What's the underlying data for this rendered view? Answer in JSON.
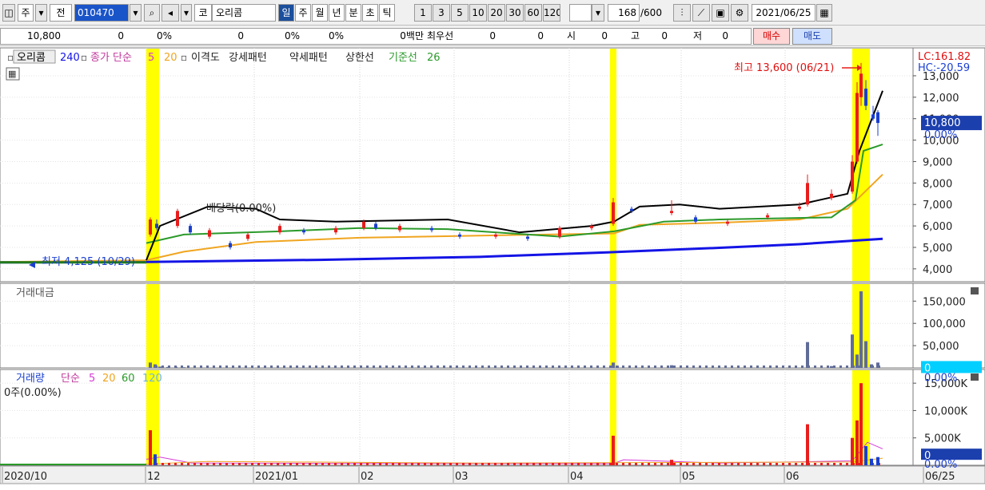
{
  "toolbar": {
    "type_main": "주",
    "type_all": "전",
    "code": "010470",
    "market": "코",
    "name": "오리콤",
    "periods": [
      "일",
      "주",
      "월",
      "년",
      "분",
      "초",
      "틱"
    ],
    "active_period": "일",
    "intervals": [
      "1",
      "3",
      "5",
      "10",
      "20",
      "30",
      "60",
      "120"
    ],
    "count": "168",
    "count_total": "/600",
    "date": "2021/06/25"
  },
  "quote": {
    "price": "10,800",
    "change": "0",
    "change_rate": "0%",
    "volume": "0",
    "vol_rate": "0%",
    "rate2": "0%",
    "amount": "0백만",
    "best_label": "최우선",
    "best_ask": "0",
    "best_bid": "0",
    "open_label": "시",
    "open": "0",
    "high_label": "고",
    "high": "0",
    "low_label": "저",
    "low": "0",
    "buy": "매수",
    "sell": "매도"
  },
  "colors": {
    "up": "#e81d1d",
    "down": "#1a3fd0",
    "highlight": "#ffff00",
    "price_box": "#1c3fae",
    "cyan_box": "#00cfff",
    "ma5": "#d63bd6",
    "ma20": "#f0a520",
    "ma60": "#2a9a2a",
    "ma120": "#6fb3e0",
    "ma240": "#1414e6",
    "baseline": "#1f7a1f",
    "envelope": "#000000"
  },
  "chart_data": [
    {
      "type": "candlestick",
      "panel": "price",
      "legend": {
        "stock": "오리콤",
        "ma240": "240",
        "close_label": "종가 단순",
        "ma5": "5",
        "ma20": "20",
        "disparity": "이격도",
        "strong": "강세패턴",
        "weak": "약세패턴",
        "limit": "상한선",
        "base": "기준선",
        "base_n": "26"
      },
      "y_ticks": [
        "13,000",
        "12,000",
        "11,000",
        "10,000",
        "9,000",
        "8,000",
        "7,000",
        "6,000",
        "5,000",
        "4,000"
      ],
      "ylim": [
        3400,
        14300
      ],
      "current_price": "10,800",
      "current_rate": "0.00%",
      "lc": "LC:161.82",
      "hc": "HC:-20.59",
      "high_note": "최고 13,600 (06/21)",
      "low_note": "최저 4,125 (10/29)",
      "dividend_note": "배당락(0.00%)",
      "x_labels": [
        "2020/10",
        "12",
        "2021/01",
        "02",
        "03",
        "04",
        "05",
        "06",
        "06/25"
      ],
      "ma240": [
        [
          0,
          4300
        ],
        [
          183,
          4320
        ],
        [
          400,
          4420
        ],
        [
          600,
          4560
        ],
        [
          768,
          4780
        ],
        [
          900,
          4980
        ],
        [
          1000,
          5150
        ],
        [
          1104,
          5400
        ]
      ],
      "ma20": [
        [
          0,
          4320
        ],
        [
          183,
          4400
        ],
        [
          230,
          4800
        ],
        [
          320,
          5250
        ],
        [
          450,
          5450
        ],
        [
          600,
          5550
        ],
        [
          768,
          5650
        ],
        [
          800,
          6050
        ],
        [
          900,
          6150
        ],
        [
          1000,
          6300
        ],
        [
          1060,
          6800
        ],
        [
          1104,
          8400
        ]
      ],
      "ma60": [
        [
          183,
          5200
        ],
        [
          230,
          5600
        ],
        [
          350,
          5750
        ],
        [
          450,
          5900
        ],
        [
          560,
          5850
        ],
        [
          700,
          5500
        ],
        [
          768,
          5750
        ],
        [
          830,
          6200
        ],
        [
          900,
          6300
        ],
        [
          1040,
          6400
        ],
        [
          1070,
          7200
        ],
        [
          1080,
          9500
        ],
        [
          1104,
          9800
        ]
      ],
      "envelope": [
        [
          183,
          4400
        ],
        [
          200,
          6000
        ],
        [
          260,
          6900
        ],
        [
          320,
          6800
        ],
        [
          350,
          6300
        ],
        [
          420,
          6200
        ],
        [
          560,
          6300
        ],
        [
          650,
          5700
        ],
        [
          740,
          6000
        ],
        [
          768,
          6200
        ],
        [
          800,
          6900
        ],
        [
          850,
          7000
        ],
        [
          900,
          6800
        ],
        [
          1000,
          7000
        ],
        [
          1060,
          7500
        ],
        [
          1075,
          9500
        ],
        [
          1104,
          12300
        ]
      ],
      "candles": [
        {
          "x": 188,
          "o": 5600,
          "c": 6300,
          "h": 6400,
          "l": 5500
        },
        {
          "x": 196,
          "o": 6100,
          "c": 5900,
          "h": 6300,
          "l": 5800
        },
        {
          "x": 222,
          "o": 6000,
          "c": 6700,
          "h": 6800,
          "l": 5900
        },
        {
          "x": 238,
          "o": 6000,
          "c": 5700,
          "h": 6100,
          "l": 5600
        },
        {
          "x": 262,
          "o": 5500,
          "c": 5800,
          "h": 5900,
          "l": 5400
        },
        {
          "x": 288,
          "o": 5200,
          "c": 5000,
          "h": 5300,
          "l": 4900
        },
        {
          "x": 310,
          "o": 5400,
          "c": 5600,
          "h": 5700,
          "l": 5300
        },
        {
          "x": 350,
          "o": 5700,
          "c": 6000,
          "h": 6100,
          "l": 5600
        },
        {
          "x": 380,
          "o": 5800,
          "c": 5700,
          "h": 5900,
          "l": 5600
        },
        {
          "x": 420,
          "o": 5700,
          "c": 5900,
          "h": 6000,
          "l": 5600
        },
        {
          "x": 455,
          "o": 5900,
          "c": 6200,
          "h": 6300,
          "l": 5800
        },
        {
          "x": 470,
          "o": 6100,
          "c": 5900,
          "h": 6200,
          "l": 5800
        },
        {
          "x": 500,
          "o": 5800,
          "c": 6000,
          "h": 6100,
          "l": 5700
        },
        {
          "x": 540,
          "o": 5900,
          "c": 5800,
          "h": 6000,
          "l": 5700
        },
        {
          "x": 575,
          "o": 5600,
          "c": 5500,
          "h": 5700,
          "l": 5400
        },
        {
          "x": 620,
          "o": 5500,
          "c": 5600,
          "h": 5700,
          "l": 5400
        },
        {
          "x": 660,
          "o": 5500,
          "c": 5400,
          "h": 5600,
          "l": 5300
        },
        {
          "x": 700,
          "o": 5500,
          "c": 5900,
          "h": 6000,
          "l": 5400
        },
        {
          "x": 740,
          "o": 5900,
          "c": 6000,
          "h": 6100,
          "l": 5800
        },
        {
          "x": 767,
          "o": 6100,
          "c": 7100,
          "h": 7300,
          "l": 6000
        },
        {
          "x": 790,
          "o": 6800,
          "c": 6700,
          "h": 6900,
          "l": 6600
        },
        {
          "x": 840,
          "o": 6600,
          "c": 6700,
          "h": 7200,
          "l": 6500
        },
        {
          "x": 870,
          "o": 6400,
          "c": 6200,
          "h": 6500,
          "l": 6100
        },
        {
          "x": 910,
          "o": 6100,
          "c": 6200,
          "h": 6300,
          "l": 6000
        },
        {
          "x": 960,
          "o": 6400,
          "c": 6500,
          "h": 6600,
          "l": 6300
        },
        {
          "x": 1000,
          "o": 6800,
          "c": 6900,
          "h": 7100,
          "l": 6700
        },
        {
          "x": 1010,
          "o": 7000,
          "c": 8000,
          "h": 8400,
          "l": 6900
        },
        {
          "x": 1040,
          "o": 7300,
          "c": 7500,
          "h": 7700,
          "l": 7200
        },
        {
          "x": 1066,
          "o": 7600,
          "c": 9000,
          "h": 9300,
          "l": 7500
        },
        {
          "x": 1072,
          "o": 9000,
          "c": 12200,
          "h": 12700,
          "l": 8900
        },
        {
          "x": 1077,
          "o": 12000,
          "c": 13100,
          "h": 13600,
          "l": 11600
        },
        {
          "x": 1083,
          "o": 12400,
          "c": 11600,
          "h": 12800,
          "l": 11400
        },
        {
          "x": 1092,
          "o": 11200,
          "c": 11000,
          "h": 11600,
          "l": 10900
        },
        {
          "x": 1098,
          "o": 11300,
          "c": 10800,
          "h": 11400,
          "l": 10200
        }
      ]
    },
    {
      "type": "bar",
      "panel": "trading_value",
      "title": "거래대금",
      "y_ticks": [
        "150,000",
        "100,000",
        "50,000"
      ],
      "ylim": [
        0,
        190000
      ],
      "current_value": "0",
      "current_rate": "0.00%",
      "bars": [
        [
          188,
          12000
        ],
        [
          194,
          8000
        ],
        [
          200,
          3000
        ],
        [
          210,
          2000
        ],
        [
          220,
          2500
        ],
        [
          230,
          1500
        ],
        [
          767,
          12000
        ],
        [
          772,
          5000
        ],
        [
          840,
          6000
        ],
        [
          1010,
          58000
        ],
        [
          1040,
          4000
        ],
        [
          1066,
          75000
        ],
        [
          1072,
          30000
        ],
        [
          1077,
          172000
        ],
        [
          1083,
          60000
        ],
        [
          1090,
          8000
        ],
        [
          1098,
          12000
        ]
      ]
    },
    {
      "type": "bar",
      "panel": "volume",
      "title": "거래량",
      "ma_label": "단순",
      "ma_periods": [
        "5",
        "20",
        "60",
        "120"
      ],
      "readout": "0주(0.00%)",
      "y_ticks": [
        "15,000K",
        "10,000K",
        "5,000K"
      ],
      "ylim": [
        0,
        17500000
      ],
      "current_value": "0",
      "current_rate": "0.00%",
      "bars": [
        [
          188,
          6400000,
          "up"
        ],
        [
          194,
          2000000,
          "down"
        ],
        [
          767,
          5400000,
          "up"
        ],
        [
          840,
          1000000,
          "up"
        ],
        [
          1010,
          7500000,
          "up"
        ],
        [
          1066,
          5000000,
          "up"
        ],
        [
          1072,
          8200000,
          "up"
        ],
        [
          1077,
          15000000,
          "up"
        ],
        [
          1083,
          3500000,
          "down"
        ],
        [
          1090,
          1200000,
          "down"
        ],
        [
          1098,
          1500000,
          "down"
        ]
      ]
    }
  ]
}
